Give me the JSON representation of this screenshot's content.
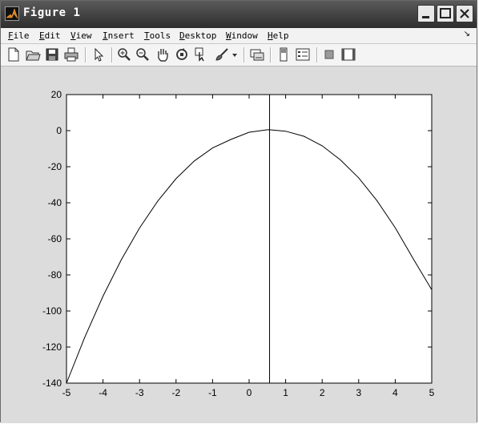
{
  "window": {
    "title": "Figure 1",
    "controls": [
      "minimize",
      "maximize",
      "close"
    ]
  },
  "menu": [
    "File",
    "Edit",
    "View",
    "Insert",
    "Tools",
    "Desktop",
    "Window",
    "Help"
  ],
  "toolbar": {
    "buttons": [
      "new-figure-icon",
      "open-file-icon",
      "save-icon",
      "print-icon",
      "edit-plot-arrow-icon",
      "zoom-in-icon",
      "zoom-out-icon",
      "pan-hand-icon",
      "rotate-3d-icon",
      "data-cursor-icon",
      "brush-icon",
      "link-plot-icon",
      "insert-colorbar-icon",
      "insert-legend-icon",
      "hide-plot-tools-icon",
      "show-plot-tools-icon"
    ]
  },
  "chart_data": {
    "type": "line",
    "title": "",
    "xlabel": "",
    "ylabel": "",
    "xlim": [
      -5,
      5
    ],
    "ylim": [
      -140,
      20
    ],
    "xticks": [
      "-5",
      "-4",
      "-3",
      "-2",
      "-1",
      "0",
      "1",
      "2",
      "3",
      "4",
      "5"
    ],
    "yticks": [
      "20",
      "0",
      "-20",
      "-40",
      "-60",
      "-80",
      "-100",
      "-120",
      "-140"
    ],
    "grid": false,
    "series": [
      {
        "x": [
          -5,
          -4.5,
          -4,
          -3.5,
          -3,
          -2.5,
          -2,
          -1.5,
          -1,
          -0.5,
          0,
          0.5,
          0.56,
          1,
          1.5,
          2,
          2.5,
          3,
          3.5,
          4,
          4.5,
          5
        ],
        "y": [
          -140,
          -114.6,
          -91.8,
          -71.6,
          -54,
          -39,
          -26.6,
          -16.8,
          -9.6,
          -4.9,
          -0.9,
          0.5,
          0.5,
          -0.3,
          -3.1,
          -8.4,
          -16.2,
          -26.2,
          -38.8,
          -53.8,
          -71.3,
          -88.2
        ]
      }
    ],
    "vertical_line_x": 0.56
  }
}
